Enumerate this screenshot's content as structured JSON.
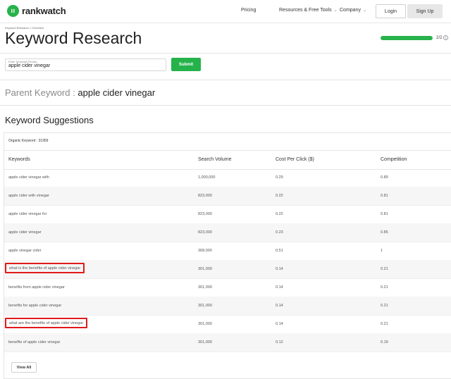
{
  "header": {
    "logo_text": "rankwatch",
    "brand_color": "#27b24a",
    "nav": [
      {
        "label": "Pricing",
        "dropdown": false
      },
      {
        "label": "Resources & Free Tools",
        "dropdown": true
      },
      {
        "label": "Company",
        "dropdown": true
      }
    ],
    "login_label": "Login",
    "signup_label": "Sign Up"
  },
  "breadcrumb": "Keyword Research > Overview",
  "page_title": "Keyword Research",
  "progress": {
    "text": "2/2",
    "fraction": 1.0
  },
  "search": {
    "label": "Enter Keyword Phrase",
    "value": "apple cider vinegar",
    "submit_label": "Submit"
  },
  "parent_keyword": {
    "label": "Parent Keyword",
    "separator": ":",
    "value": "apple cider vinegar"
  },
  "suggestions": {
    "title": "Keyword Suggestions",
    "organic_label": "Organic Keyword :",
    "organic_count": "31959",
    "columns": [
      "Keywords",
      "Search Volume",
      "Cost Per Click ($)",
      "Competition"
    ],
    "rows": [
      {
        "keyword": "apple cider vinegar with",
        "volume": "1,000,000",
        "cpc": "0.29",
        "competition": "0.89",
        "highlighted": false
      },
      {
        "keyword": "apple cider with vinegar",
        "volume": "823,000",
        "cpc": "0.22",
        "competition": "0.81",
        "highlighted": false
      },
      {
        "keyword": "apple cider vinegar for",
        "volume": "823,000",
        "cpc": "0.22",
        "competition": "0.81",
        "highlighted": false
      },
      {
        "keyword": "apple cider vinegar",
        "volume": "823,000",
        "cpc": "0.23",
        "competition": "0.85",
        "highlighted": false
      },
      {
        "keyword": "apple vinegar cider",
        "volume": "368,000",
        "cpc": "0.51",
        "competition": "1",
        "highlighted": false
      },
      {
        "keyword": "what is the benefits of apple cider vinegar",
        "volume": "301,000",
        "cpc": "0.14",
        "competition": "0.21",
        "highlighted": true
      },
      {
        "keyword": "benefits from apple cider vinegar",
        "volume": "301,000",
        "cpc": "0.14",
        "competition": "0.21",
        "highlighted": false
      },
      {
        "keyword": "benefits for apple cider vinegar",
        "volume": "301,000",
        "cpc": "0.14",
        "competition": "0.21",
        "highlighted": false
      },
      {
        "keyword": "what are the benefits of apple cider vinegar",
        "volume": "301,000",
        "cpc": "0.14",
        "competition": "0.21",
        "highlighted": true
      },
      {
        "keyword": "benefits of apple cider vinegar",
        "volume": "301,000",
        "cpc": "0.12",
        "competition": "0.19",
        "highlighted": false
      }
    ],
    "view_all_label": "View All",
    "highlight_color": "#e01b1b"
  }
}
